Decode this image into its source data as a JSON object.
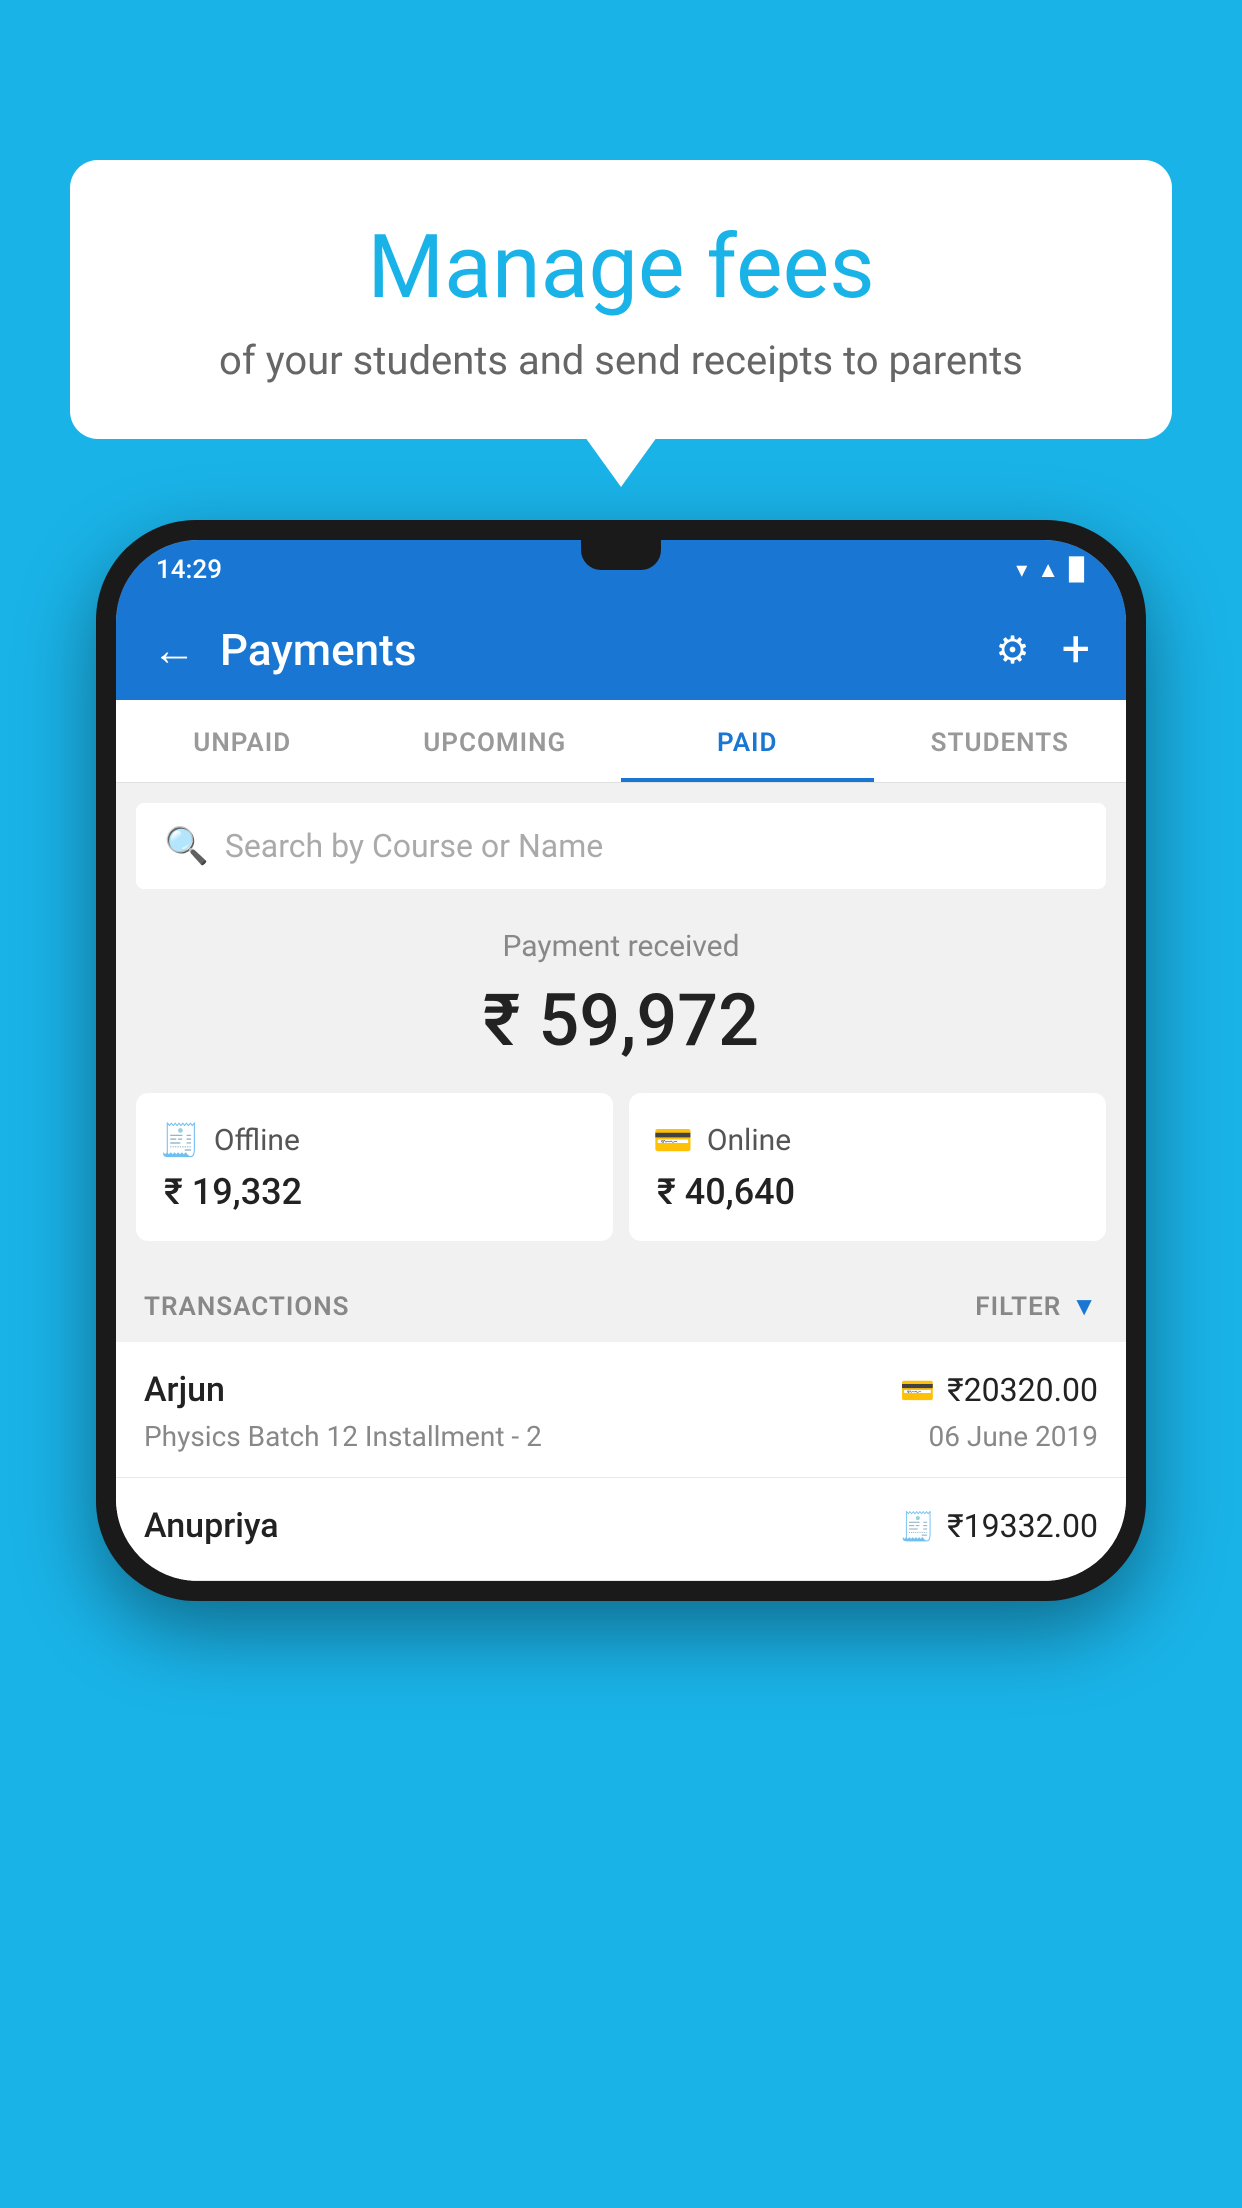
{
  "background_color": "#1ab3e8",
  "bubble": {
    "title": "Manage fees",
    "subtitle": "of your students and send receipts to parents"
  },
  "status_bar": {
    "time": "14:29",
    "icons": [
      "wifi",
      "signal",
      "battery"
    ]
  },
  "top_bar": {
    "title": "Payments",
    "back_label": "←",
    "settings_label": "⚙",
    "add_label": "+"
  },
  "tabs": [
    {
      "label": "UNPAID",
      "active": false
    },
    {
      "label": "UPCOMING",
      "active": false
    },
    {
      "label": "PAID",
      "active": true
    },
    {
      "label": "STUDENTS",
      "active": false
    }
  ],
  "search": {
    "placeholder": "Search by Course or Name"
  },
  "payment": {
    "received_label": "Payment received",
    "total_amount": "₹ 59,972",
    "offline_label": "Offline",
    "offline_amount": "₹ 19,332",
    "online_label": "Online",
    "online_amount": "₹ 40,640"
  },
  "transactions": {
    "section_label": "TRANSACTIONS",
    "filter_label": "FILTER",
    "rows": [
      {
        "name": "Arjun",
        "course": "Physics Batch 12 Installment - 2",
        "amount": "₹20320.00",
        "date": "06 June 2019",
        "method": "online"
      },
      {
        "name": "Anupriya",
        "course": "",
        "amount": "₹19332.00",
        "date": "",
        "method": "offline"
      }
    ]
  }
}
